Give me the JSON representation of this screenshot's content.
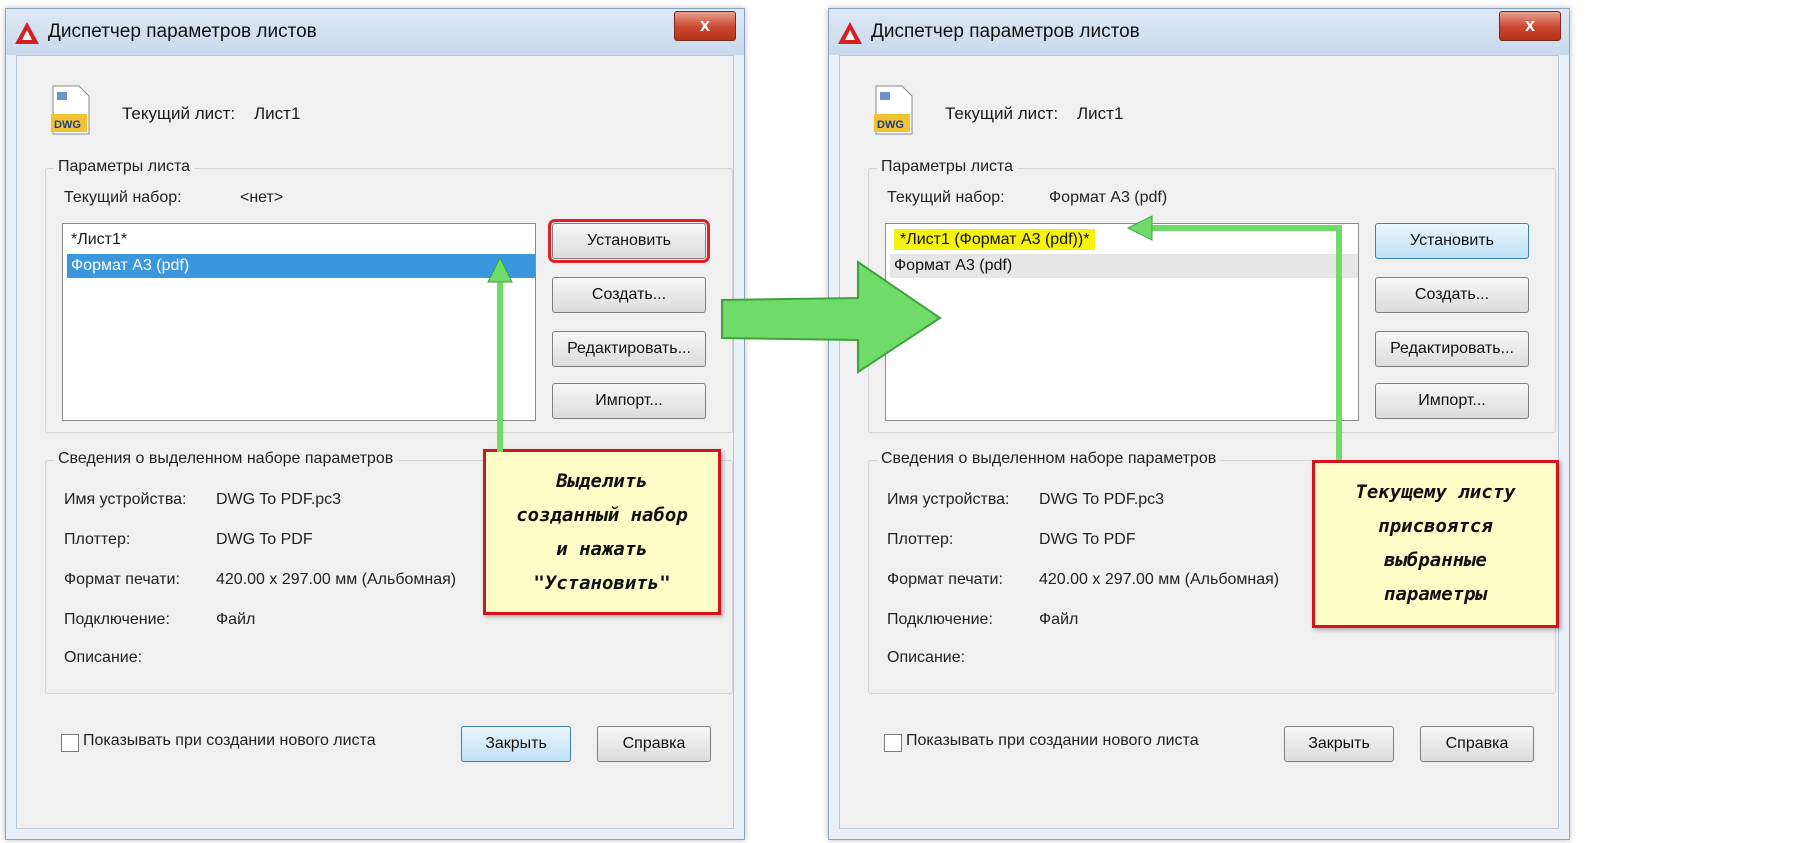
{
  "dialog": {
    "title": "Диспетчер параметров листов",
    "close_label": "x",
    "current_sheet_label": "Текущий лист:",
    "current_sheet_value": "Лист1",
    "group1_title": "Параметры листа",
    "current_set_label": "Текущий набор:",
    "group2_title": "Сведения о выделенном наборе параметров",
    "device_label": "Имя устройства:",
    "device_value": "DWG To PDF.pc3",
    "plotter_label": "Плоттер:",
    "plotter_value": "DWG To PDF",
    "paper_label": "Формат печати:",
    "paper_value": "420.00 x 297.00 мм (Альбомная)",
    "connection_label": "Подключение:",
    "connection_value": "Файл",
    "description_label": "Описание:",
    "btn_set": "Установить",
    "btn_create": "Создать...",
    "btn_edit": "Редактировать...",
    "btn_import": "Импорт...",
    "show_checkbox_label": "Показывать при создании нового листа",
    "btn_close": "Закрыть",
    "btn_help": "Справка",
    "dwg_icon_text": "DWG"
  },
  "left": {
    "current_set_value": "<нет>",
    "list_items": [
      "*Лист1*",
      "Формат А3 (pdf)"
    ],
    "note_lines": [
      "Выделить",
      "созданный набор",
      "и нажать",
      "\"Установить\""
    ]
  },
  "right": {
    "current_set_value": "Формат А3 (pdf)",
    "list_items": [
      "*Лист1 (Формат А3 (pdf))*",
      "Формат А3 (pdf)"
    ],
    "note_lines": [
      "Текущему листу",
      "присвоятся",
      "выбранные",
      "параметры"
    ]
  },
  "colors": {
    "selection": "#3a96dd",
    "arrow_green": "#6fdc6a",
    "note_border": "#d4141c",
    "note_bg": "#fffcc8",
    "highlight_yellow": "#f5f20d"
  },
  "icons": {
    "app": "autocad-icon",
    "file": "dwg-file-icon",
    "arrow": "green-arrow"
  }
}
